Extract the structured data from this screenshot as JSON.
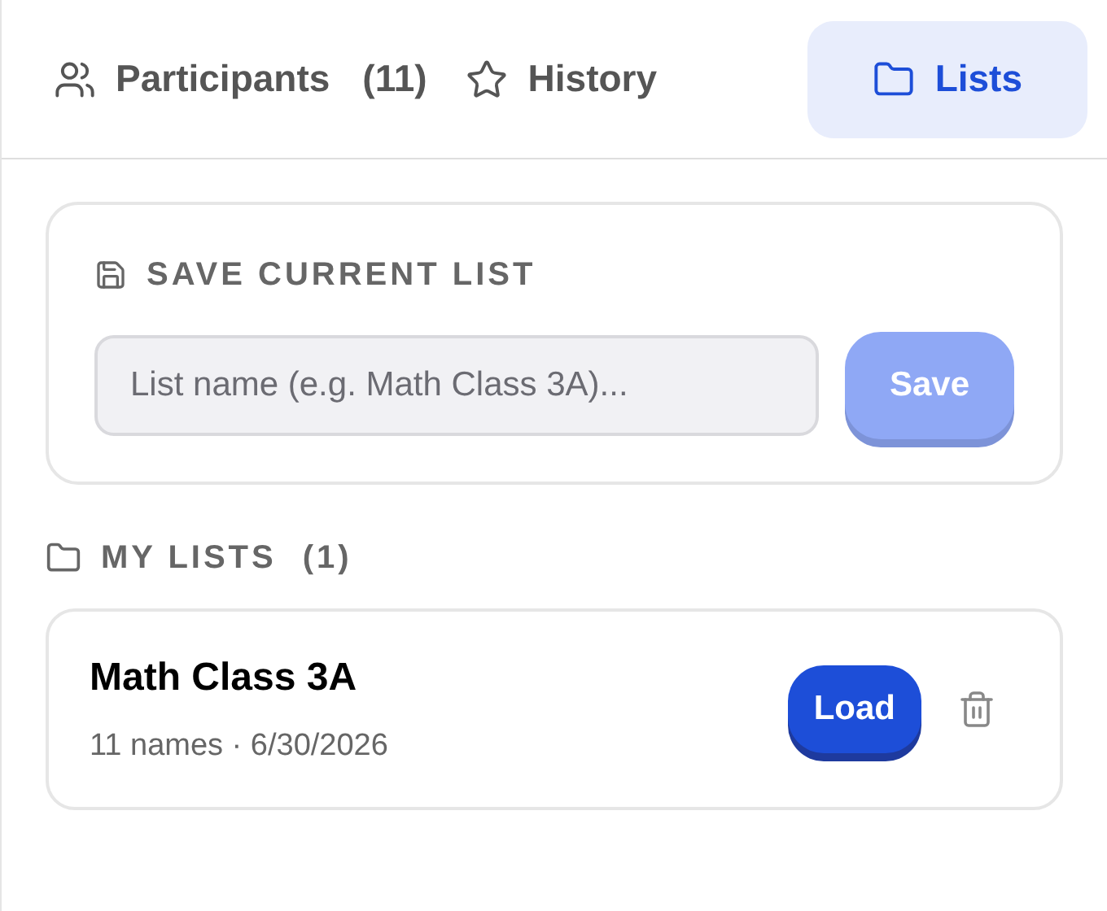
{
  "tabs": [
    {
      "label": "Participants",
      "count": "(11)",
      "selected": false
    },
    {
      "label": "History",
      "selected": false
    },
    {
      "label": "Lists",
      "selected": true
    }
  ],
  "save_card": {
    "title": "SAVE CURRENT LIST",
    "input": {
      "placeholder": "List name (e.g. Math Class 3A)..."
    },
    "button": {
      "label": "Save",
      "disabled": true
    }
  },
  "my_lists": {
    "title": "MY LISTS",
    "count": "(1)",
    "items": [
      {
        "name": "Math Class 3A",
        "meta": "11 names · 6/30/2026",
        "button": "Load"
      }
    ]
  }
}
